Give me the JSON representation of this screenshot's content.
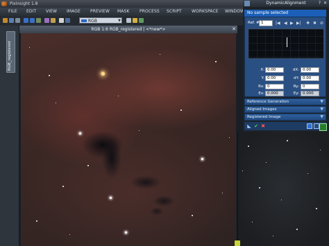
{
  "window": {
    "title": "PixInsight 1.8"
  },
  "menu": [
    "FILE",
    "EDIT",
    "VIEW",
    "IMAGE",
    "PREVIEW",
    "MASK",
    "PROCESS",
    "SCRIPT",
    "WORKSPACE",
    "WINDOW"
  ],
  "toolbar": {
    "view_select": "RGB"
  },
  "side_tab": {
    "label": "RGB_registered"
  },
  "image_window": {
    "title": "RGB 1:6 RGB_registered | <*new*>"
  },
  "panel": {
    "title": "DynamicAlignment",
    "status": "No sample selected",
    "ref_label": "Ref. #:",
    "ref_value": "1",
    "fields": {
      "x_label": "X:",
      "x_value": "0.00",
      "dx_label": "dX:",
      "dx_value": "0.00",
      "y_label": "Y:",
      "y_value": "0.00",
      "dy_label": "dY:",
      "dy_value": "0.00",
      "rx_label": "Rx:",
      "rx_value": "0",
      "ry_label": "Ry:",
      "ry_value": "0",
      "ex_label": "Ex:",
      "ex_value": "0.000",
      "ey_label": "Ey:",
      "ey_value": "0.000"
    },
    "sections": [
      "Reference Generation",
      "Aligned Images",
      "Registered Image"
    ]
  }
}
